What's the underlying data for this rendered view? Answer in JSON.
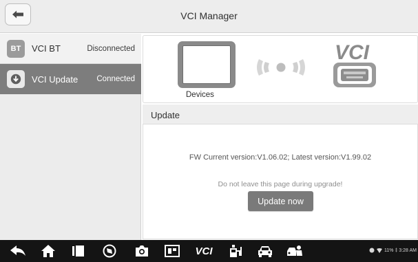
{
  "header": {
    "title": "VCI Manager",
    "back_icon": "arrow-left-icon"
  },
  "sidebar": {
    "items": [
      {
        "icon_text": "BT",
        "label": "VCI BT",
        "status": "Disconnected",
        "active": false
      },
      {
        "icon": "download-circle-icon",
        "label": "VCI Update",
        "status": "Connected",
        "active": true
      }
    ]
  },
  "devices": {
    "label": "Devices",
    "vci_text": "VCI"
  },
  "update": {
    "section_title": "Update",
    "fw_version": "FW Current version:V1.06.02; Latest version:V1.99.02",
    "warning": "Do not leave this page during upgrade!",
    "button_label": "Update now"
  },
  "navbar": {
    "icons": [
      "back-icon",
      "home-icon",
      "recent-apps-icon",
      "browser-icon",
      "camera-icon",
      "screenshot-icon",
      "vci-shortcut-icon",
      "fuel-icon",
      "car-icon",
      "car-service-icon"
    ],
    "vci_label": "VCI",
    "status_text": "11% ‡ 3:28 AM"
  },
  "colors": {
    "header_bg": "#ededed",
    "sidebar_active_bg": "#7d7d7d",
    "button_bg": "#7a7a7a",
    "navbar_bg": "#141414"
  }
}
